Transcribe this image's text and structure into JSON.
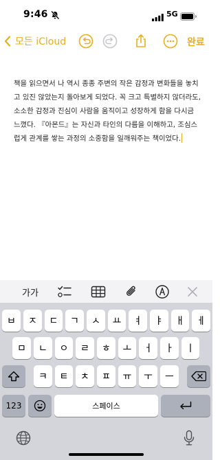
{
  "status_bar": {
    "time": "9:46",
    "network": "5G"
  },
  "nav": {
    "back_label": "모든 iCloud",
    "done_label": "완료",
    "accent_color": "#E8AE1C",
    "icons": [
      "chevron-left-icon",
      "undo-icon",
      "redo-icon",
      "share-icon",
      "more-icon"
    ]
  },
  "note": {
    "text": "책을 읽으면서 나 역시 종종 주변의 작은 감정과 변화들을 놓치고 있진 않았는지 돌아보게 되었다. 꼭 크고 특별하지 않더라도, 소소한 감정과 진심이 사람을 움직이고 성장하게 함을 다시금 느꼈다. 『아몬드』는 자신과 타인의 다름을 이해하고, 조심스럽게 관계를 쌓는 과정의 소중함을 일깨워주는 책이었다."
  },
  "toolbar": {
    "aa_label": "가가",
    "icons": [
      "checklist-icon",
      "table-icon",
      "paperclip-icon",
      "pen-markup-icon",
      "close-icon"
    ]
  },
  "keyboard": {
    "row1": [
      "ㅂ",
      "ㅈ",
      "ㄷ",
      "ㄱ",
      "ㅅ",
      "ㅛ",
      "ㅕ",
      "ㅑ",
      "ㅐ",
      "ㅔ"
    ],
    "row2": [
      "ㅁ",
      "ㄴ",
      "ㅇ",
      "ㄹ",
      "ㅎ",
      "ㅗ",
      "ㅓ",
      "ㅏ",
      "ㅣ"
    ],
    "row3": [
      "ㅋ",
      "ㅌ",
      "ㅊ",
      "ㅍ",
      "ㅠ",
      "ㅜ",
      "ㅡ"
    ],
    "numbers_label": "123",
    "space_label": "스페이스"
  }
}
